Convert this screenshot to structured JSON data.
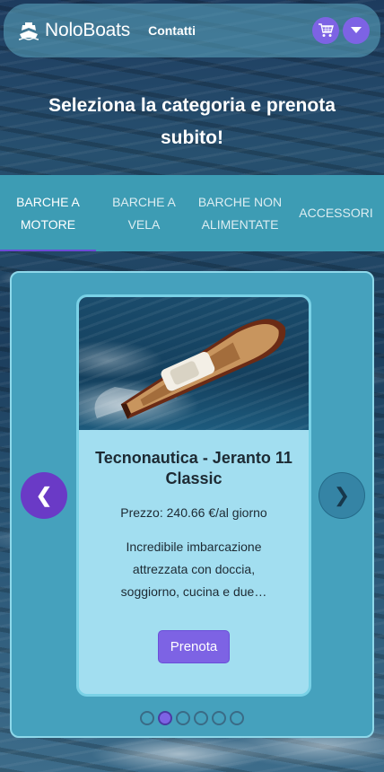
{
  "header": {
    "brand": "NoloBoats",
    "nav_link": "Contatti",
    "cart_icon": "cart-icon",
    "menu_icon": "chevron-down-icon"
  },
  "hero": {
    "title": "Seleziona la categoria e prenota subito!"
  },
  "tabs": [
    {
      "label": "BARCHE A MOTORE",
      "active": true
    },
    {
      "label": "BARCHE A VELA",
      "active": false
    },
    {
      "label": "BARCHE NON ALIMENTATE",
      "active": false
    },
    {
      "label": "ACCESSORI",
      "active": false
    }
  ],
  "carousel": {
    "prev_label": "❮",
    "next_label": "❯",
    "card": {
      "title": "Tecnonautica - Jeranto 11 Classic",
      "price": "Prezzo: 240.66 €/al giorno",
      "description": "Incredibile imbarcazione attrezzata con doccia, soggiorno, cucina e due…",
      "button": "Prenota"
    },
    "slide_count": 6,
    "active_slide": 2
  },
  "colors": {
    "accent": "#7d63e4",
    "tab_bar": "#3d9cb4",
    "card_bg": "#a2def0"
  }
}
